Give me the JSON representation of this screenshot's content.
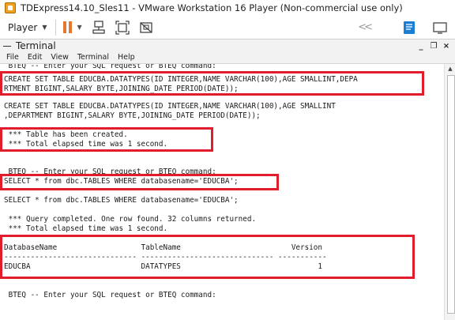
{
  "window": {
    "title": "TDExpress14.10_Sles11 - VMware Workstation 16 Player (Non-commercial use only)",
    "app_icon": "vmware-player-icon"
  },
  "toolbar": {
    "player_label": "Player",
    "icons": [
      "pause-icon",
      "send-ctrl-alt-del-icon",
      "fit-guest-icon",
      "unity-icon",
      "back-arrows-icon",
      "notes-icon",
      "fullscreen-icon"
    ]
  },
  "terminal": {
    "title": "Terminal",
    "window_controls": [
      "_",
      "❐",
      "×"
    ],
    "menu": [
      "File",
      "Edit",
      "View",
      "Terminal",
      "Help"
    ],
    "lines": [
      " BTEQ -- Enter your SQL request or BTEQ command:",
      "CREATE SET TABLE EDUCBA.DATATYPES(ID INTEGER,NAME VARCHAR(100),AGE SMALLINT,DEPA",
      "RTMENT BIGINT,SALARY BYTE,JOINING_DATE PERIOD(DATE));",
      "",
      "CREATE SET TABLE EDUCBA.DATATYPES(ID INTEGER,NAME VARCHAR(100),AGE SMALLINT",
      ",DEPARTMENT BIGINT,SALARY BYTE,JOINING_DATE PERIOD(DATE));",
      "",
      " *** Table has been created.",
      " *** Total elapsed time was 1 second.",
      "",
      "",
      " BTEQ -- Enter your SQL request or BTEQ command:",
      "SELECT * from dbc.TABLES WHERE databasename='EDUCBA';",
      "",
      "SELECT * from dbc.TABLES WHERE databasename='EDUCBA';",
      "",
      " *** Query completed. One row found. 32 columns returned.",
      " *** Total elapsed time was 1 second.",
      "",
      "DatabaseName                   TableName                         Version",
      "------------------------------ ------------------------------ -----------",
      "EDUCBA                         DATATYPES                               1",
      "",
      "",
      " BTEQ -- Enter your SQL request or BTEQ command:"
    ]
  },
  "colors": {
    "highlight": "#e11d2b",
    "pause": "#e8772e",
    "notes": "#1a7fd4"
  }
}
